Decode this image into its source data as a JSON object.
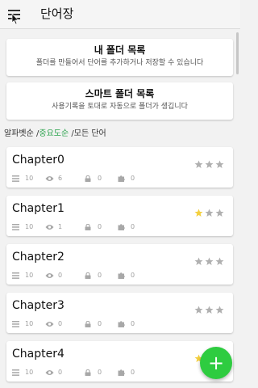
{
  "app_bar": {
    "title": "단어장"
  },
  "folders": [
    {
      "title": "내 폴더 목록",
      "subtitle": "폴더를 만들어서 단어를 추가하거나 저장할 수 있습니다"
    },
    {
      "title": "스마트 폴더 목록",
      "subtitle": "사용기록을 토대로 자동으로 폴더가 생깁니다"
    }
  ],
  "sort": {
    "option1": "알파벳순",
    "sep1": " /",
    "option2": "중요도순",
    "sep2": " /",
    "option3": "모든 단어",
    "active": "중요도순",
    "active_color": "#2ea44f"
  },
  "chapters": [
    {
      "name": "Chapter0",
      "words": "10",
      "views": "6",
      "locked": "0",
      "puzzles": "0",
      "stars_filled": 0
    },
    {
      "name": "Chapter1",
      "words": "10",
      "views": "1",
      "locked": "0",
      "puzzles": "0",
      "stars_filled": 1
    },
    {
      "name": "Chapter2",
      "words": "10",
      "views": "0",
      "locked": "0",
      "puzzles": "0",
      "stars_filled": 0
    },
    {
      "name": "Chapter3",
      "words": "10",
      "views": "0",
      "locked": "0",
      "puzzles": "0",
      "stars_filled": 0
    },
    {
      "name": "Chapter4",
      "words": "10",
      "views": "0",
      "locked": "0",
      "puzzles": "0",
      "stars_filled": 1
    }
  ],
  "stars_total": 3,
  "colors": {
    "star_filled": "#f4d03f",
    "star_empty": "#b0b0b0",
    "fab": "#2ecc40",
    "accent": "#2ea44f"
  },
  "icons": {
    "menu": "menu-icon",
    "words": "list-icon",
    "views": "eye-icon",
    "locked": "lock-icon",
    "puzzles": "puzzle-icon",
    "star": "star-icon",
    "fab": "plus-icon"
  },
  "fab": {
    "label": "+"
  }
}
